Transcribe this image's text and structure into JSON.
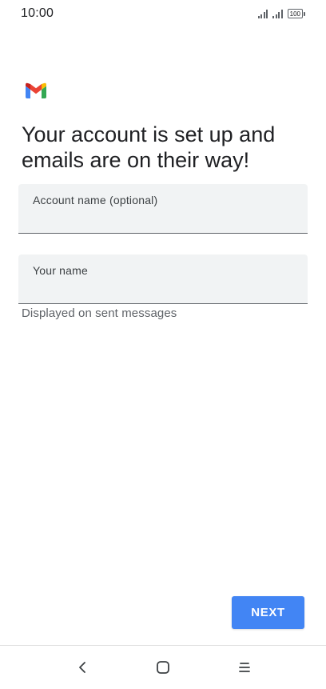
{
  "status_bar": {
    "time": "10:00",
    "battery": "100",
    "icons": [
      "signal-icon",
      "signal-icon",
      "battery-icon"
    ]
  },
  "app": {
    "logo": "gmail-logo-icon"
  },
  "title": "Your account is set up and emails are on their way!",
  "fields": {
    "account_name": {
      "label": "Account name (optional)",
      "value": ""
    },
    "your_name": {
      "label": "Your name",
      "value": "",
      "helper": "Displayed on sent messages"
    }
  },
  "actions": {
    "next_label": "NEXT"
  },
  "colors": {
    "accent": "#4285f4",
    "field_bg": "#f1f3f4",
    "text": "#202124",
    "helper_text": "#5f6368"
  },
  "nav_bar": {
    "icons": [
      "back-icon",
      "home-icon",
      "menu-icon"
    ]
  }
}
